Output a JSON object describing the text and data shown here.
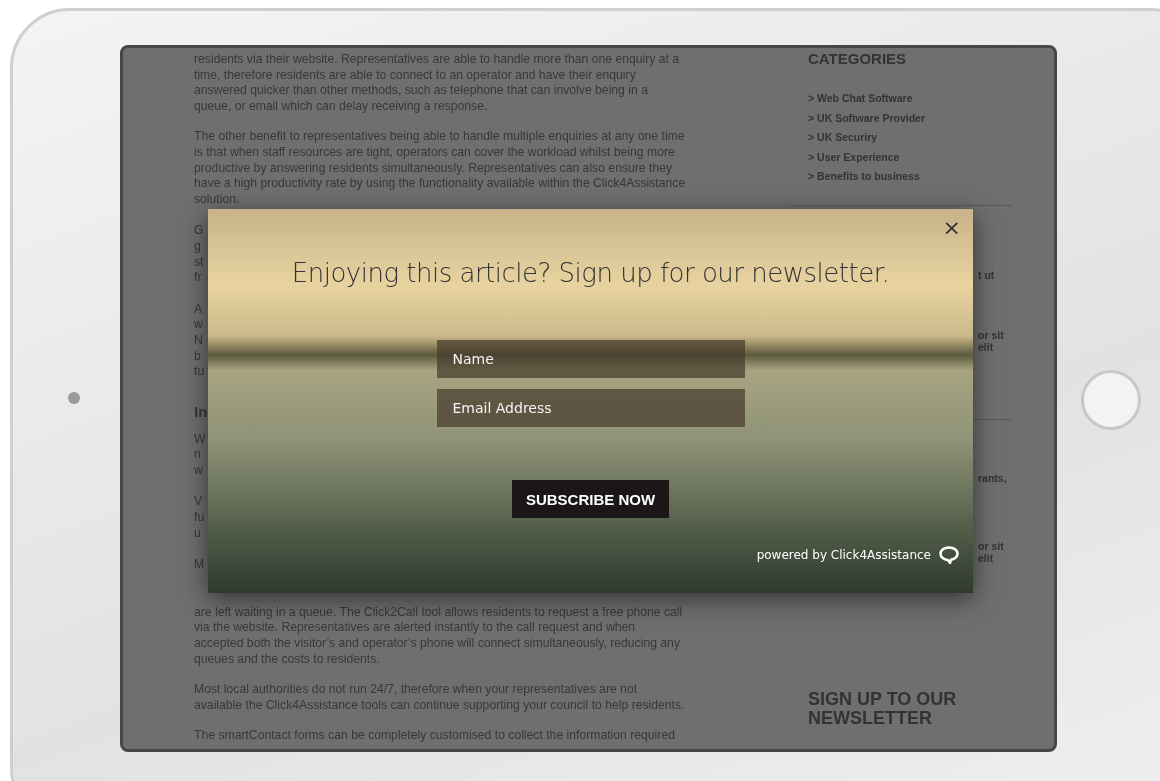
{
  "article": {
    "top_paragraphs": [
      "residents via their website. Representatives are able to handle more than one enquiry at a time, therefore residents are able to connect to an operator and have their enquiry answered quicker than other methods, such as telephone that can involve being in a queue, or email which can delay receiving a response.",
      "The other benefit to representatives being able to handle multiple enquiries at any one time is that when staff resources are tight, operators can cover the workload whilst being more productive by answering residents simultaneously. Representatives can also ensure they have a high productivity rate by using the functionality available within the Click4Assistance solution."
    ],
    "fragments": [
      {
        "kind": "lines",
        "lines": [
          "G",
          "g",
          "st",
          "fr"
        ]
      },
      {
        "kind": "lines",
        "lines": [
          "A",
          "w",
          "N",
          "b",
          "tu"
        ]
      },
      {
        "kind": "heading",
        "lines": [
          "In"
        ]
      },
      {
        "kind": "lines",
        "lines": [
          "W",
          "n",
          "w"
        ]
      },
      {
        "kind": "lines",
        "lines": [
          "V",
          "fu",
          "u"
        ]
      },
      {
        "kind": "lines",
        "lines": [
          "M"
        ]
      }
    ],
    "bottom_paragraphs": [
      "are left waiting in a queue. The Click2Call tool allows residents to request a free phone call via the website. Representatives are alerted instantly to the call request and when accepted both the visitor’s and operator’s phone will connect simultaneously, reducing any queues and the costs to residents.",
      "Most local authorities do not run 24/7, therefore when your representatives are not available the Click4Assistance tools can continue supporting your council to help residents.",
      "The smartContact forms can be completely customised to collect the information required"
    ]
  },
  "sidebar": {
    "heading": "CATEGORIES",
    "categories": [
      ">  Web Chat Software",
      ">  UK Software Provider",
      ">  UK Securiry",
      ">  User Experience",
      ">  Benefits to business"
    ],
    "fragments_upper": [
      [
        "t ut"
      ],
      [
        "or sit",
        "elit"
      ]
    ],
    "fragments_lower": [
      [
        "rants,"
      ],
      [
        "or sit",
        "elit"
      ]
    ],
    "newsletter_heading": "SIGN UP TO OUR NEWSLETTER"
  },
  "popup": {
    "heading": "Enjoying this article? Sign up for our newsletter.",
    "close": "×",
    "fields": [
      {
        "placeholder": "Name"
      },
      {
        "placeholder": "Email Address"
      }
    ],
    "button": "SUBSCRIBE NOW",
    "powered_by": "powered by Click4Assistance"
  }
}
